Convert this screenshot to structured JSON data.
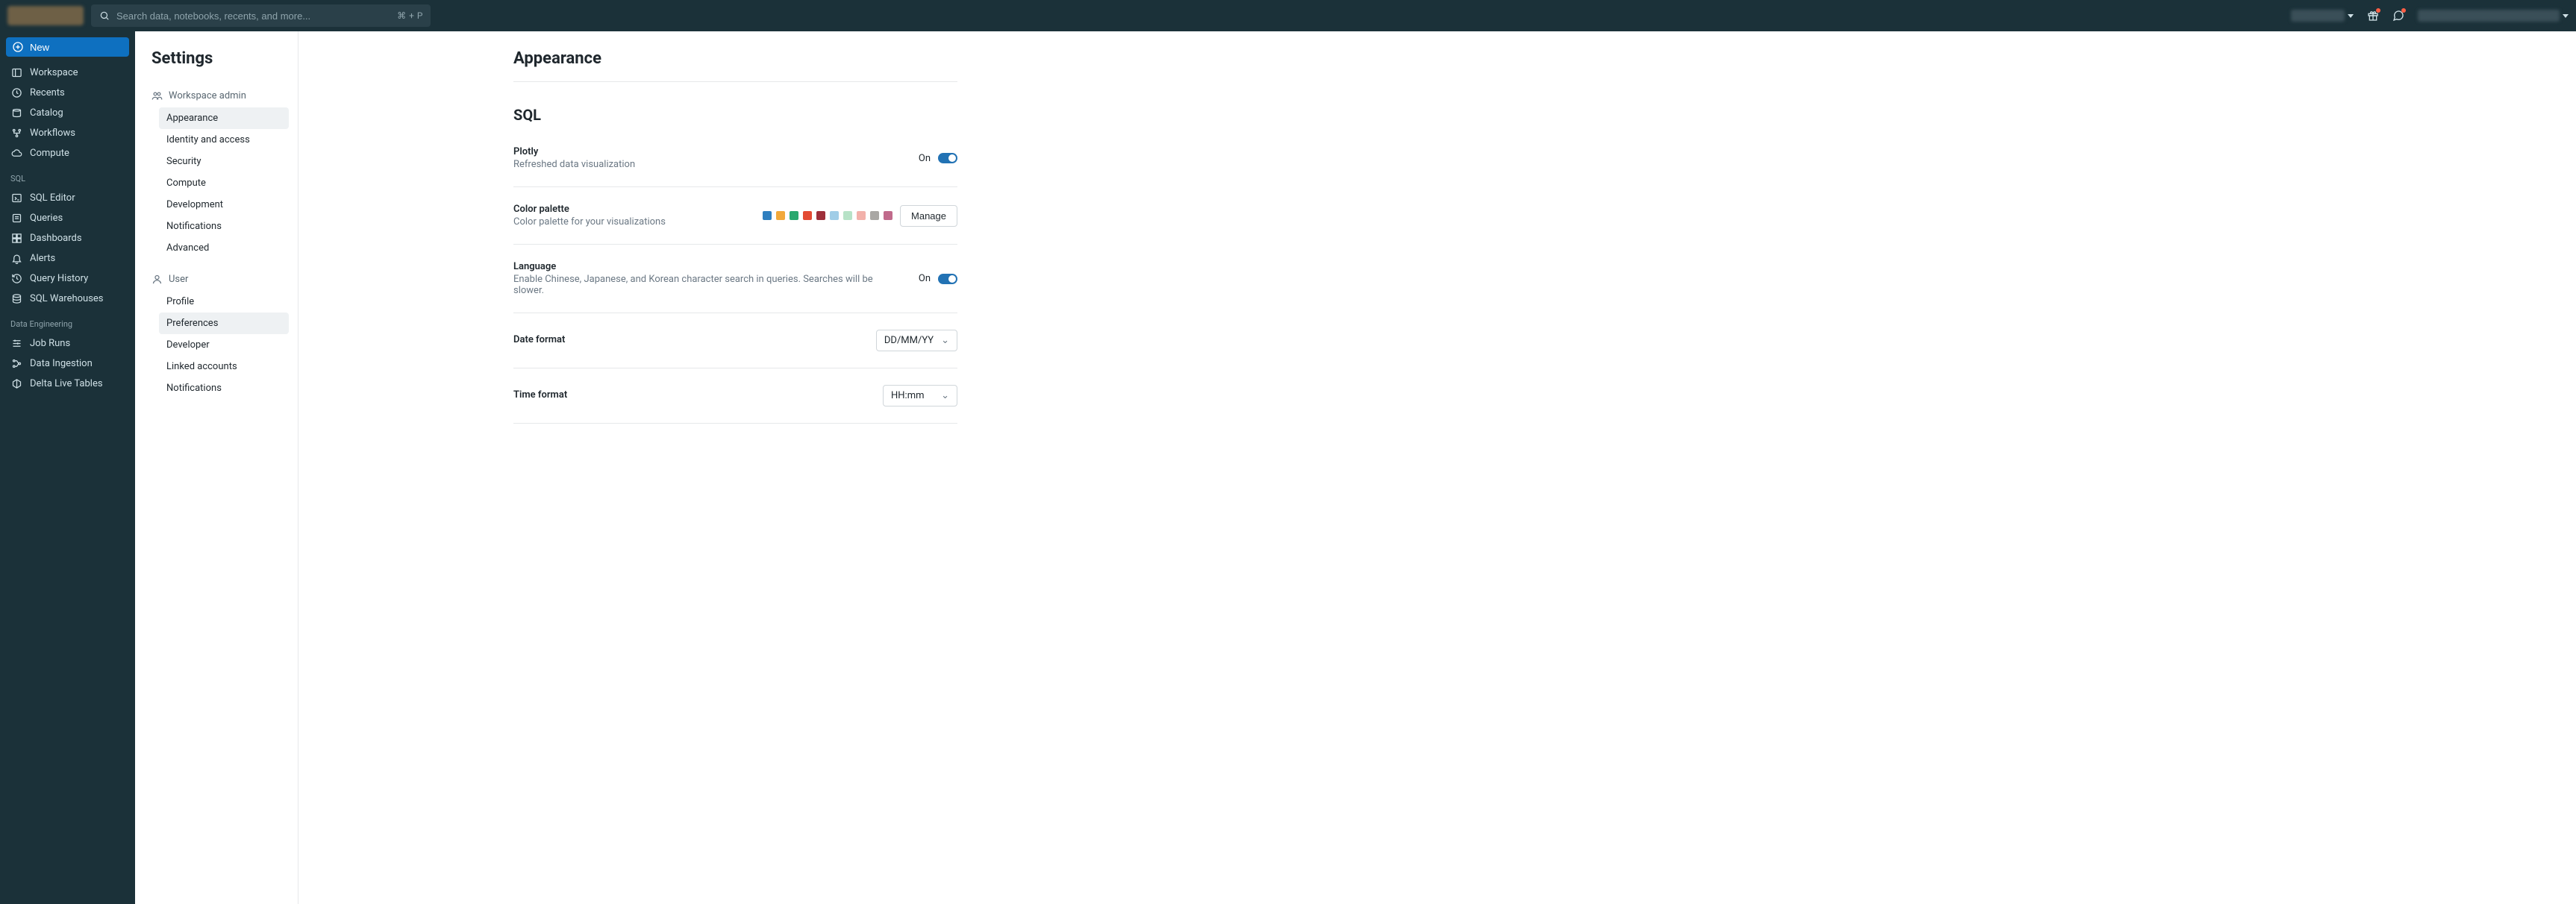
{
  "search": {
    "placeholder": "Search data, notebooks, recents, and more...",
    "shortcut": "⌘ + P"
  },
  "new_button_label": "New",
  "leftnav": {
    "main": [
      {
        "label": "Workspace",
        "icon": "workspace-icon"
      },
      {
        "label": "Recents",
        "icon": "clock-icon"
      },
      {
        "label": "Catalog",
        "icon": "catalog-icon"
      },
      {
        "label": "Workflows",
        "icon": "workflows-icon"
      },
      {
        "label": "Compute",
        "icon": "cloud-icon"
      }
    ],
    "sql_header": "SQL",
    "sql": [
      {
        "label": "SQL Editor",
        "icon": "sql-editor-icon"
      },
      {
        "label": "Queries",
        "icon": "queries-icon"
      },
      {
        "label": "Dashboards",
        "icon": "dashboards-icon"
      },
      {
        "label": "Alerts",
        "icon": "bell-icon"
      },
      {
        "label": "Query History",
        "icon": "history-icon"
      },
      {
        "label": "SQL Warehouses",
        "icon": "warehouse-icon"
      }
    ],
    "de_header": "Data Engineering",
    "de": [
      {
        "label": "Job Runs",
        "icon": "job-runs-icon"
      },
      {
        "label": "Data Ingestion",
        "icon": "ingestion-icon"
      },
      {
        "label": "Delta Live Tables",
        "icon": "dlt-icon"
      }
    ]
  },
  "settings": {
    "title": "Settings",
    "workspace_admin_header": "Workspace admin",
    "workspace_admin": [
      "Appearance",
      "Identity and access",
      "Security",
      "Compute",
      "Development",
      "Notifications",
      "Advanced"
    ],
    "user_header": "User",
    "user": [
      "Profile",
      "Preferences",
      "Developer",
      "Linked accounts",
      "Notifications"
    ],
    "active_admin": "Appearance",
    "active_user": "Preferences"
  },
  "page": {
    "title": "Appearance",
    "section": "SQL",
    "plotly": {
      "label": "Plotly",
      "desc": "Refreshed data visualization",
      "state": "On"
    },
    "palette": {
      "label": "Color palette",
      "desc": "Color palette for your visualizations",
      "manage_label": "Manage",
      "colors": [
        "#2f7fbf",
        "#f2a93b",
        "#2aa86f",
        "#e34a33",
        "#9e2f3a",
        "#a0cde7",
        "#b7e2c7",
        "#f2b1aa",
        "#a9a7a4",
        "#c06a8b"
      ]
    },
    "language": {
      "label": "Language",
      "desc": "Enable Chinese, Japanese, and Korean character search in queries. Searches will be slower.",
      "state": "On"
    },
    "date_format": {
      "label": "Date format",
      "value": "DD/MM/YY"
    },
    "time_format": {
      "label": "Time format",
      "value": "HH:mm"
    }
  }
}
